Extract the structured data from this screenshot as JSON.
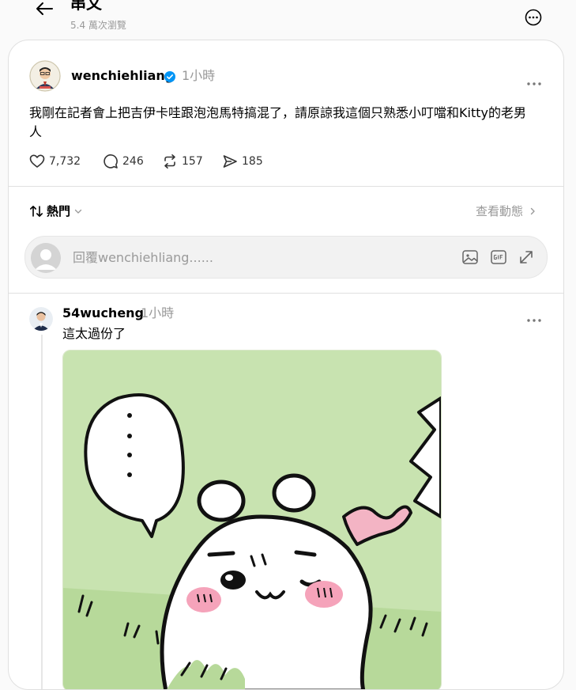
{
  "header": {
    "title": "串文",
    "views": "5.4 萬次瀏覽"
  },
  "post": {
    "username": "wenchiehliang",
    "time": "1小時",
    "text": "我剛在記者會上把吉伊卡哇跟泡泡馬特搞混了，請原諒我這個只熟悉小叮噹和Kitty的老男人",
    "likes": "7,732",
    "comments": "246",
    "reposts": "157",
    "shares": "185"
  },
  "sort": {
    "label": "熱門",
    "activity_label": "查看動態"
  },
  "reply": {
    "placeholder": "回覆wenchiehliang......"
  },
  "comment": {
    "username": "54wucheng",
    "time": "1小時",
    "text": "這太過份了"
  },
  "colors": {
    "verified": "#0095f6",
    "divider": "#e0e0e0",
    "muted": "#999999",
    "image_bg": "#c8e3b0",
    "blush": "#f5a3ba"
  }
}
